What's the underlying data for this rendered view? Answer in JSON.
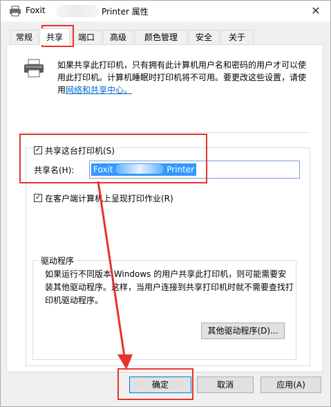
{
  "window": {
    "title_prefix": "Foxit",
    "title_suffix": "Printer 属性",
    "close_glyph": "✕"
  },
  "tabs": [
    {
      "label": "常规"
    },
    {
      "label": "共享"
    },
    {
      "label": "端口"
    },
    {
      "label": "高级"
    },
    {
      "label": "颜色管理"
    },
    {
      "label": "安全"
    },
    {
      "label": "关于"
    }
  ],
  "share": {
    "description": "如果共享此打印机，只有拥有此计算机用户名和密码的用户才可以使用此打印机。计算机睡眠时打印机将不可用。要更改这些设置，请使用",
    "link_text": "网络和共享中心。",
    "share_checkbox_label": "共享这台打印机(S)",
    "share_name_label": "共享名(H):",
    "share_name_prefix": "Foxit",
    "share_name_suffix": "Printer",
    "render_jobs_label": "在客户端计算机上呈现打印作业(R)"
  },
  "drivers": {
    "title": "驱动程序",
    "description": "如果运行不同版本 Windows 的用户共享此打印机，则可能需要安装其他驱动程序。这样，当用户连接到共享打印机时就不需要查找打印机驱动程序。",
    "other_drivers_button": "其他驱动程序(D)..."
  },
  "buttons": {
    "ok": "确定",
    "cancel": "取消",
    "apply": "应用(A)"
  },
  "colors": {
    "annotation_red": "#e5322d",
    "selection_blue": "#3399ff",
    "link_blue": "#0066cc"
  }
}
